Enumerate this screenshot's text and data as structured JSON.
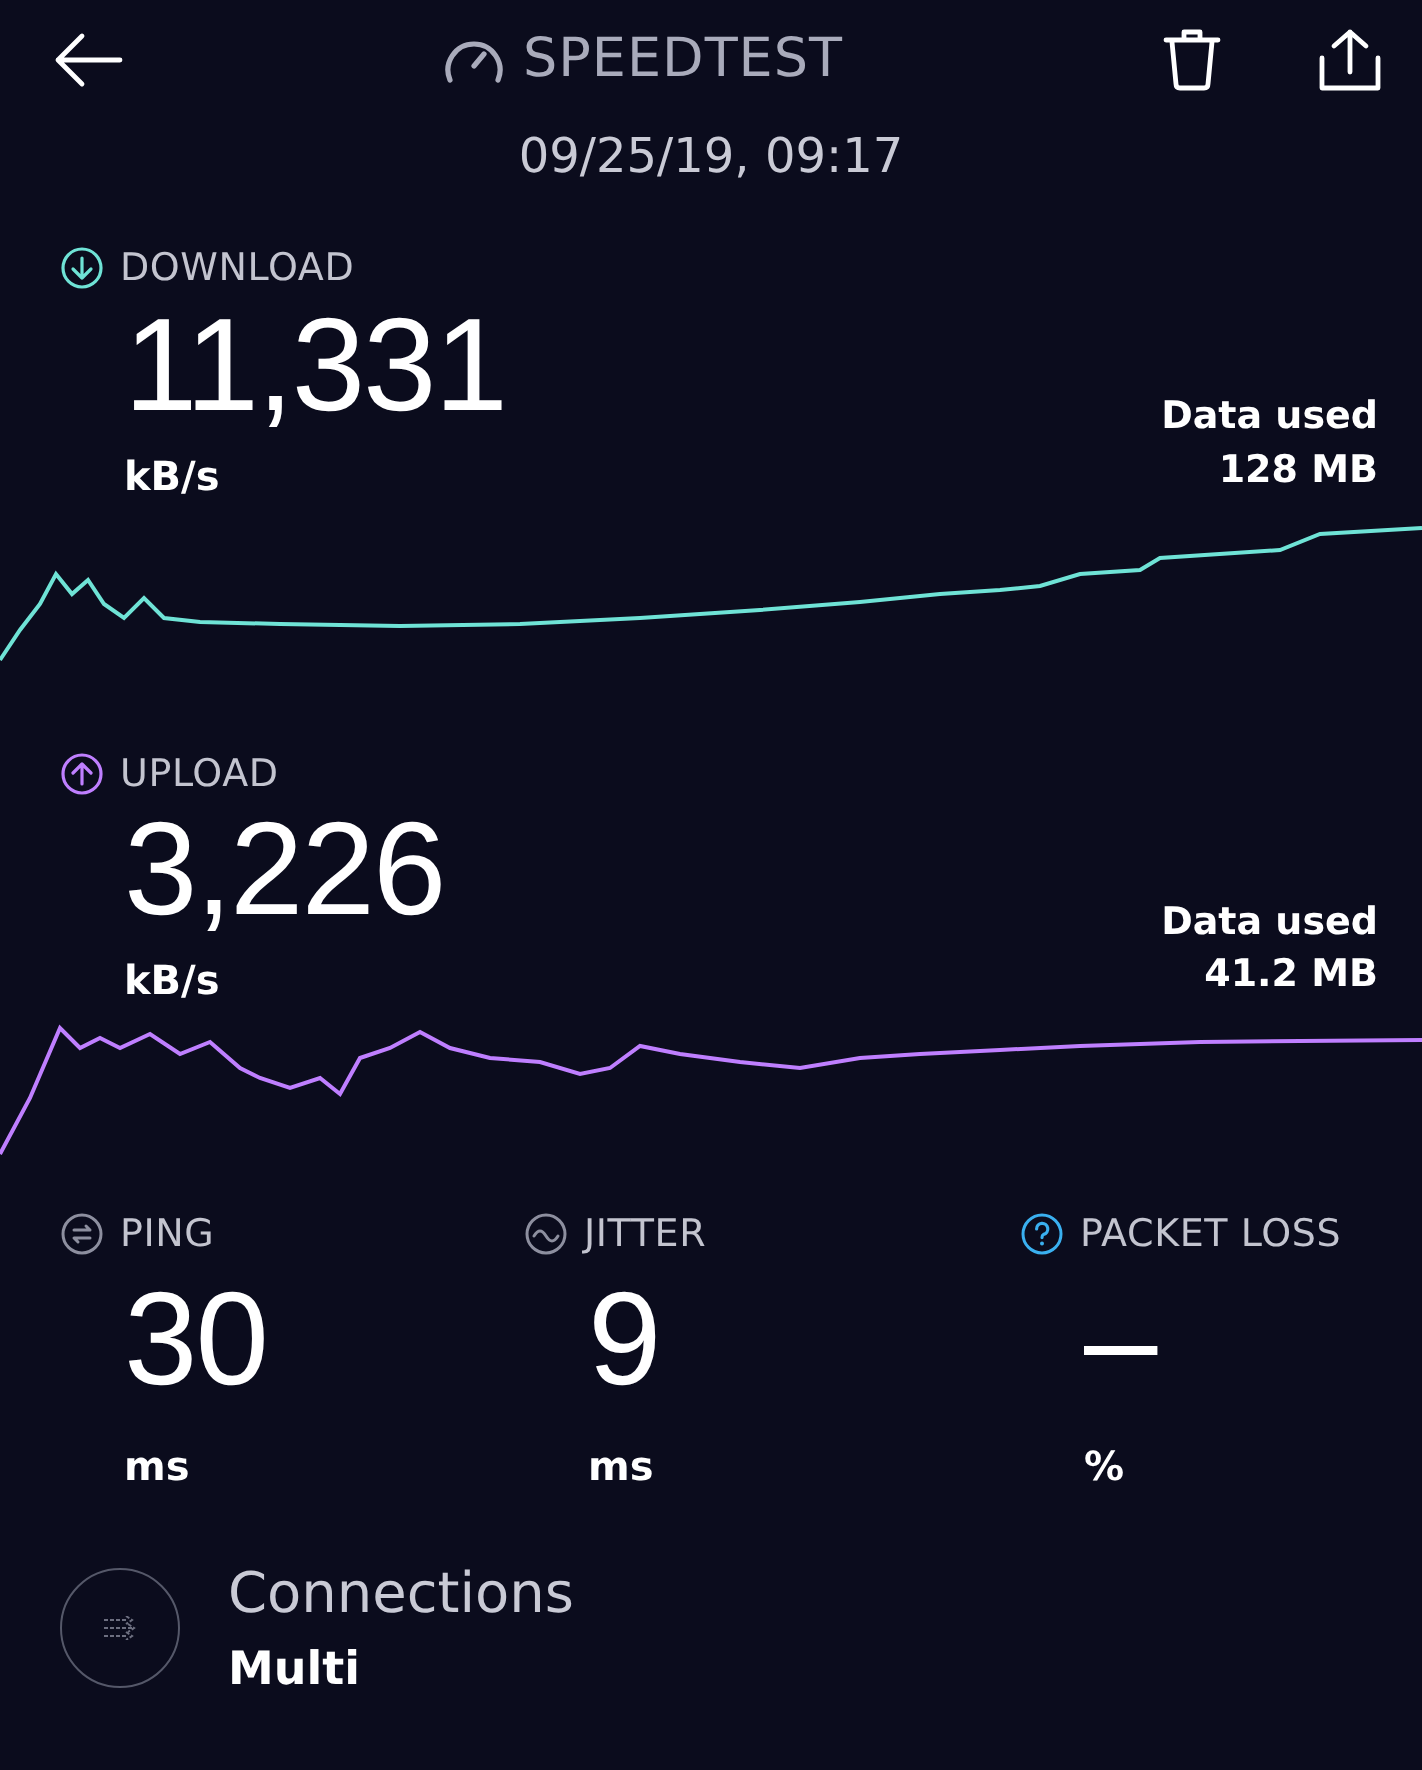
{
  "header": {
    "title": "SPEEDTEST",
    "date": "09/25/19, 09:17"
  },
  "speeds": [
    {
      "kind": "download",
      "label": "DOWNLOAD",
      "value": "11,331",
      "unit": "kB/s",
      "data_label": "Data used",
      "data_value": "128 MB"
    },
    {
      "kind": "upload",
      "label": "UPLOAD",
      "value": "3,226",
      "unit": "kB/s",
      "data_label": "Data used",
      "data_value": "41.2 MB"
    }
  ],
  "metrics": [
    {
      "kind": "ping",
      "label": "PING",
      "value": "30",
      "unit": "ms"
    },
    {
      "kind": "jitter",
      "label": "JITTER",
      "value": "9",
      "unit": "ms"
    },
    {
      "kind": "packet_loss",
      "label": "PACKET LOSS",
      "value": "–",
      "unit": "%"
    }
  ],
  "connections": {
    "label": "Connections",
    "value": "Multi"
  }
}
